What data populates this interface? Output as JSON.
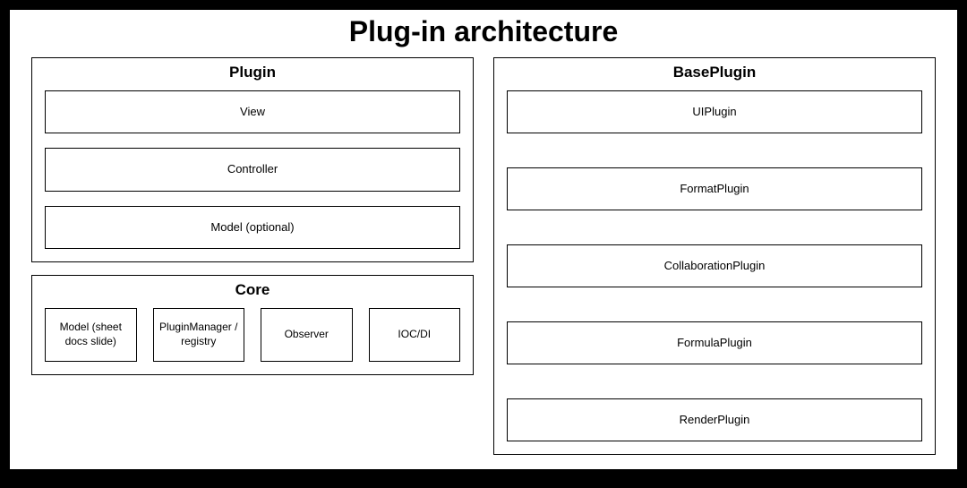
{
  "title": "Plug-in architecture",
  "plugin": {
    "title": "Plugin",
    "items": [
      "View",
      "Controller",
      "Model (optional)"
    ]
  },
  "core": {
    "title": "Core",
    "items": [
      "Model (sheet docs slide)",
      "PluginManager / registry",
      "Observer",
      "IOC/DI"
    ]
  },
  "baseplugin": {
    "title": "BasePlugin",
    "items": [
      "UIPlugin",
      "FormatPlugin",
      "CollaborationPlugin",
      "FormulaPlugin",
      "RenderPlugin"
    ]
  }
}
